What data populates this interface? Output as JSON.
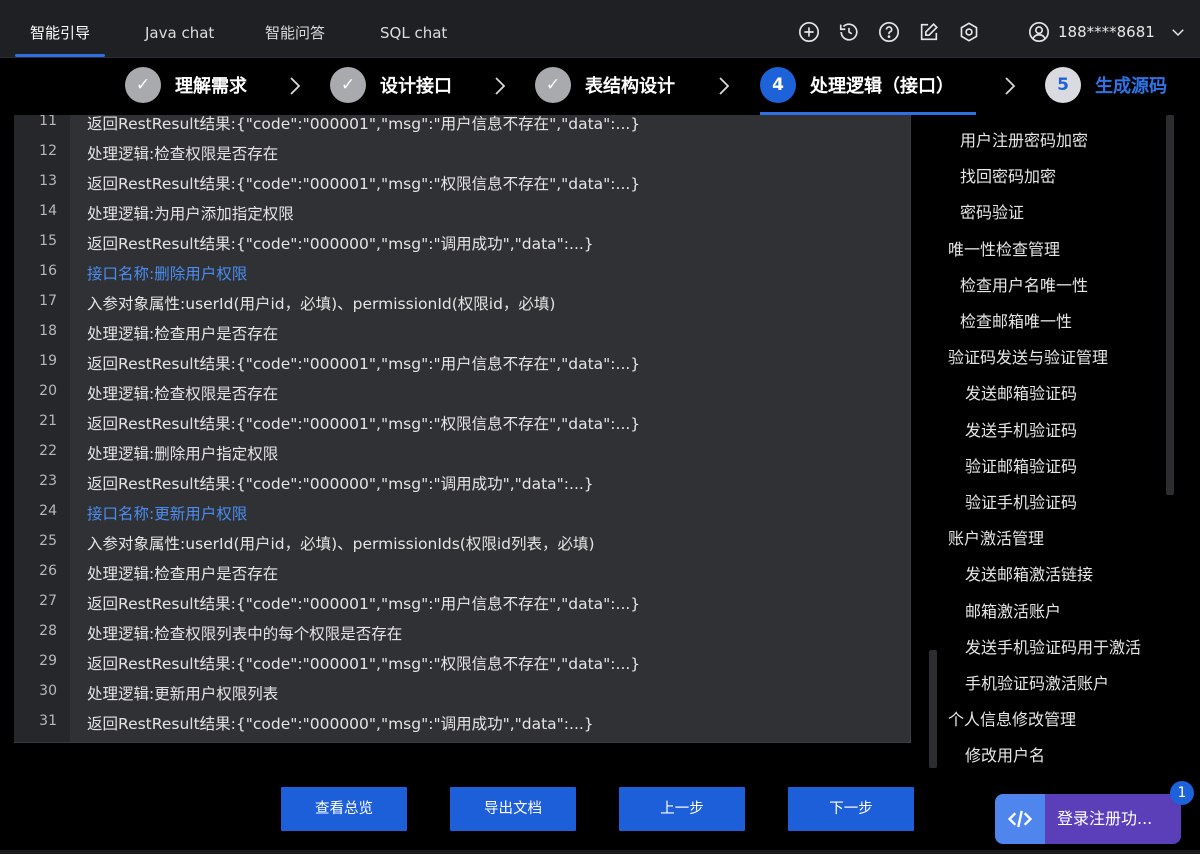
{
  "nav": {
    "tabs": [
      {
        "label": "智能引导",
        "active": true
      },
      {
        "label": "Java chat",
        "active": false
      },
      {
        "label": "智能问答",
        "active": false
      },
      {
        "label": "SQL chat",
        "active": false
      }
    ],
    "icons": [
      "plus-circle-icon",
      "history-icon",
      "help-icon",
      "edit-icon",
      "settings-hex-icon"
    ],
    "user": {
      "phone": "188****8681",
      "icon": "user-avatar-icon"
    }
  },
  "steps": [
    {
      "marker": "✓",
      "label": "理解需求",
      "state": "done"
    },
    {
      "marker": "✓",
      "label": "设计接口",
      "state": "done"
    },
    {
      "marker": "✓",
      "label": "表结构设计",
      "state": "done"
    },
    {
      "marker": "4",
      "label": "处理逻辑（接口）",
      "state": "current"
    },
    {
      "marker": "5",
      "label": "生成源码",
      "state": "pending"
    }
  ],
  "code": [
    {
      "num": "11",
      "text": "返回RestResult结果:{\"code\":\"000001\",\"msg\":\"用户信息不存在\",\"data\":...}",
      "heading": false
    },
    {
      "num": "12",
      "text": "处理逻辑:检查权限是否存在",
      "heading": false
    },
    {
      "num": "13",
      "text": "返回RestResult结果:{\"code\":\"000001\",\"msg\":\"权限信息不存在\",\"data\":...}",
      "heading": false
    },
    {
      "num": "14",
      "text": "处理逻辑:为用户添加指定权限",
      "heading": false
    },
    {
      "num": "15",
      "text": "返回RestResult结果:{\"code\":\"000000\",\"msg\":\"调用成功\",\"data\":...}",
      "heading": false
    },
    {
      "num": "16",
      "text": "接口名称:删除用户权限",
      "heading": true
    },
    {
      "num": "17",
      "text": "入参对象属性:userId(用户id，必填)、permissionId(权限id，必填)",
      "heading": false
    },
    {
      "num": "18",
      "text": "处理逻辑:检查用户是否存在",
      "heading": false
    },
    {
      "num": "19",
      "text": "返回RestResult结果:{\"code\":\"000001\",\"msg\":\"用户信息不存在\",\"data\":...}",
      "heading": false
    },
    {
      "num": "20",
      "text": "处理逻辑:检查权限是否存在",
      "heading": false
    },
    {
      "num": "21",
      "text": "返回RestResult结果:{\"code\":\"000001\",\"msg\":\"权限信息不存在\",\"data\":...}",
      "heading": false
    },
    {
      "num": "22",
      "text": "处理逻辑:删除用户指定权限",
      "heading": false
    },
    {
      "num": "23",
      "text": "返回RestResult结果:{\"code\":\"000000\",\"msg\":\"调用成功\",\"data\":...}",
      "heading": false
    },
    {
      "num": "24",
      "text": "接口名称:更新用户权限",
      "heading": true
    },
    {
      "num": "25",
      "text": "入参对象属性:userId(用户id，必填)、permissionIds(权限id列表，必填)",
      "heading": false
    },
    {
      "num": "26",
      "text": "处理逻辑:检查用户是否存在",
      "heading": false
    },
    {
      "num": "27",
      "text": "返回RestResult结果:{\"code\":\"000001\",\"msg\":\"用户信息不存在\",\"data\":...}",
      "heading": false
    },
    {
      "num": "28",
      "text": "处理逻辑:检查权限列表中的每个权限是否存在",
      "heading": false
    },
    {
      "num": "29",
      "text": "返回RestResult结果:{\"code\":\"000001\",\"msg\":\"权限信息不存在\",\"data\":...}",
      "heading": false
    },
    {
      "num": "30",
      "text": "处理逻辑:更新用户权限列表",
      "heading": false
    },
    {
      "num": "31",
      "text": "返回RestResult结果:{\"code\":\"000000\",\"msg\":\"调用成功\",\"data\":...}",
      "heading": false
    }
  ],
  "outline": [
    {
      "label": "用户注册密码加密",
      "level": 1
    },
    {
      "label": "找回密码加密",
      "level": 1
    },
    {
      "label": "密码验证",
      "level": 1
    },
    {
      "label": "唯一性检查管理",
      "level": 0
    },
    {
      "label": "检查用户名唯一性",
      "level": 1
    },
    {
      "label": "检查邮箱唯一性",
      "level": 1
    },
    {
      "label": "验证码发送与验证管理",
      "level": 0
    },
    {
      "label": "发送邮箱验证码",
      "level": 2
    },
    {
      "label": "发送手机验证码",
      "level": 2
    },
    {
      "label": "验证邮箱验证码",
      "level": 2
    },
    {
      "label": "验证手机验证码",
      "level": 2
    },
    {
      "label": "账户激活管理",
      "level": 0
    },
    {
      "label": "发送邮箱激活链接",
      "level": 2
    },
    {
      "label": "邮箱激活账户",
      "level": 2
    },
    {
      "label": "发送手机验证码用于激活",
      "level": 2
    },
    {
      "label": "手机验证码激活账户",
      "level": 2
    },
    {
      "label": "个人信息修改管理",
      "level": 0
    },
    {
      "label": "修改用户名",
      "level": 2
    }
  ],
  "buttons": {
    "overview": "查看总览",
    "export": "导出文档",
    "prev": "上一步",
    "next": "下一步"
  },
  "widget": {
    "label": "登录注册功...",
    "badge": "1",
    "icon": "code-brackets-icon"
  },
  "colors": {
    "accent": "#1d62d8",
    "heading_link": "#4a8cf0",
    "widget_purple": "#5b3fb8"
  }
}
